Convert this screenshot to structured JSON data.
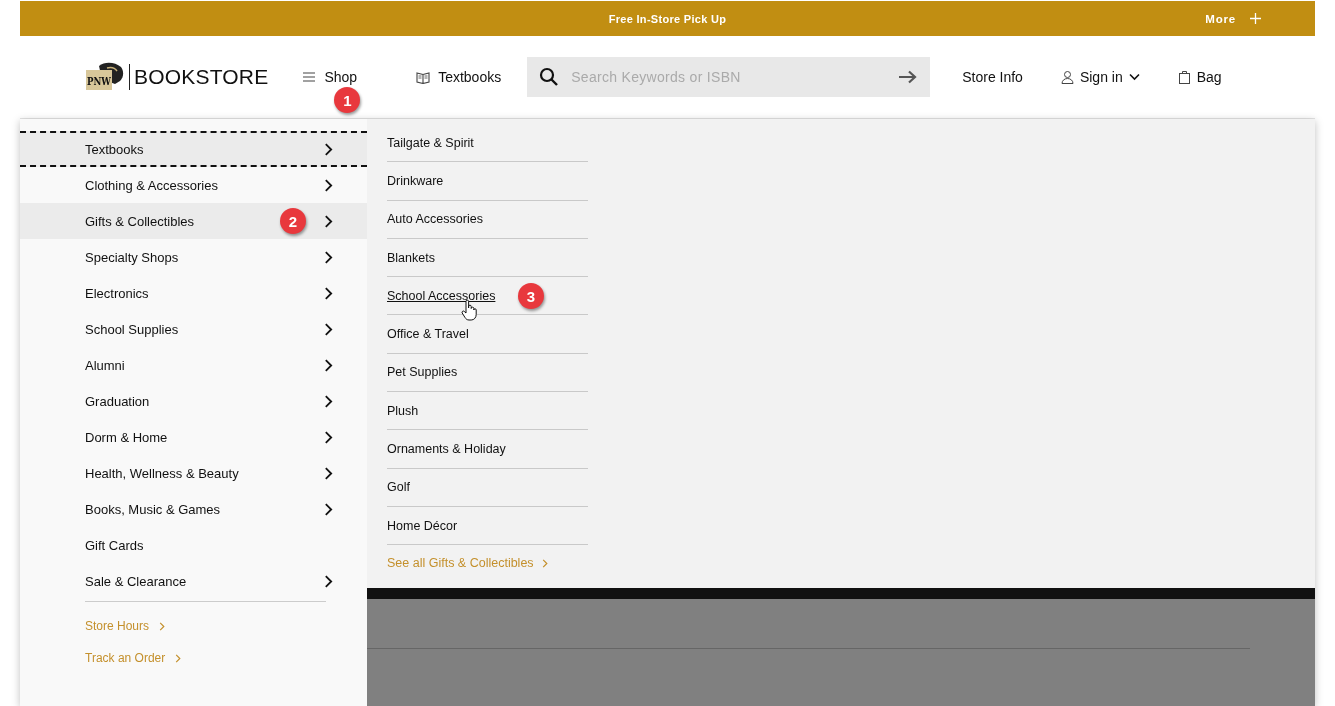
{
  "banner": {
    "message": "Free In-Store Pick Up",
    "more_label": "More"
  },
  "logo": {
    "mark": "PNW",
    "wordmark": "BOOKSTORE"
  },
  "nav": [
    {
      "kind": "menu",
      "label": "Shop",
      "callout": "1"
    },
    {
      "kind": "textbooks",
      "label": "Textbooks"
    }
  ],
  "search": {
    "placeholder": "Search Keywords or ISBN"
  },
  "utility": [
    {
      "kind": "text",
      "label": "Store Info"
    },
    {
      "kind": "account",
      "label": "Sign in"
    },
    {
      "kind": "bag",
      "label": "Bag"
    }
  ],
  "categories": [
    {
      "label": "Textbooks",
      "selected": true,
      "focused": true,
      "has_submenu": true
    },
    {
      "label": "Clothing & Accessories",
      "selected": false,
      "focused": false,
      "has_submenu": true
    },
    {
      "label": "Gifts & Collectibles",
      "selected": true,
      "focused": false,
      "has_submenu": true,
      "callout": "2"
    },
    {
      "label": "Specialty Shops",
      "selected": false,
      "focused": false,
      "has_submenu": true
    },
    {
      "label": "Electronics",
      "selected": false,
      "focused": false,
      "has_submenu": true
    },
    {
      "label": "School Supplies",
      "selected": false,
      "focused": false,
      "has_submenu": true
    },
    {
      "label": "Alumni",
      "selected": false,
      "focused": false,
      "has_submenu": true
    },
    {
      "label": "Graduation",
      "selected": false,
      "focused": false,
      "has_submenu": true
    },
    {
      "label": "Dorm & Home",
      "selected": false,
      "focused": false,
      "has_submenu": true
    },
    {
      "label": "Health, Wellness & Beauty",
      "selected": false,
      "focused": false,
      "has_submenu": true
    },
    {
      "label": "Books, Music & Games",
      "selected": false,
      "focused": false,
      "has_submenu": true
    },
    {
      "label": "Gift Cards",
      "selected": false,
      "focused": false,
      "has_submenu": false
    },
    {
      "label": "Sale & Clearance",
      "selected": false,
      "focused": false,
      "has_submenu": true
    }
  ],
  "links": [
    {
      "label": "Store Hours"
    },
    {
      "label": "Track an Order"
    }
  ],
  "submenu": {
    "items": [
      {
        "label": "Tailgate & Spirit",
        "hovered": false
      },
      {
        "label": "Drinkware",
        "hovered": false
      },
      {
        "label": "Auto Accessories",
        "hovered": false
      },
      {
        "label": "Blankets",
        "hovered": false
      },
      {
        "label": "School Accessories",
        "hovered": true,
        "callout": "3"
      },
      {
        "label": "Office & Travel",
        "hovered": false
      },
      {
        "label": "Pet Supplies",
        "hovered": false
      },
      {
        "label": "Plush",
        "hovered": false
      },
      {
        "label": "Ornaments & Holiday",
        "hovered": false
      },
      {
        "label": "Golf",
        "hovered": false
      },
      {
        "label": "Home Décor",
        "hovered": false
      }
    ],
    "see_all": "See all Gifts & Collectibles"
  }
}
